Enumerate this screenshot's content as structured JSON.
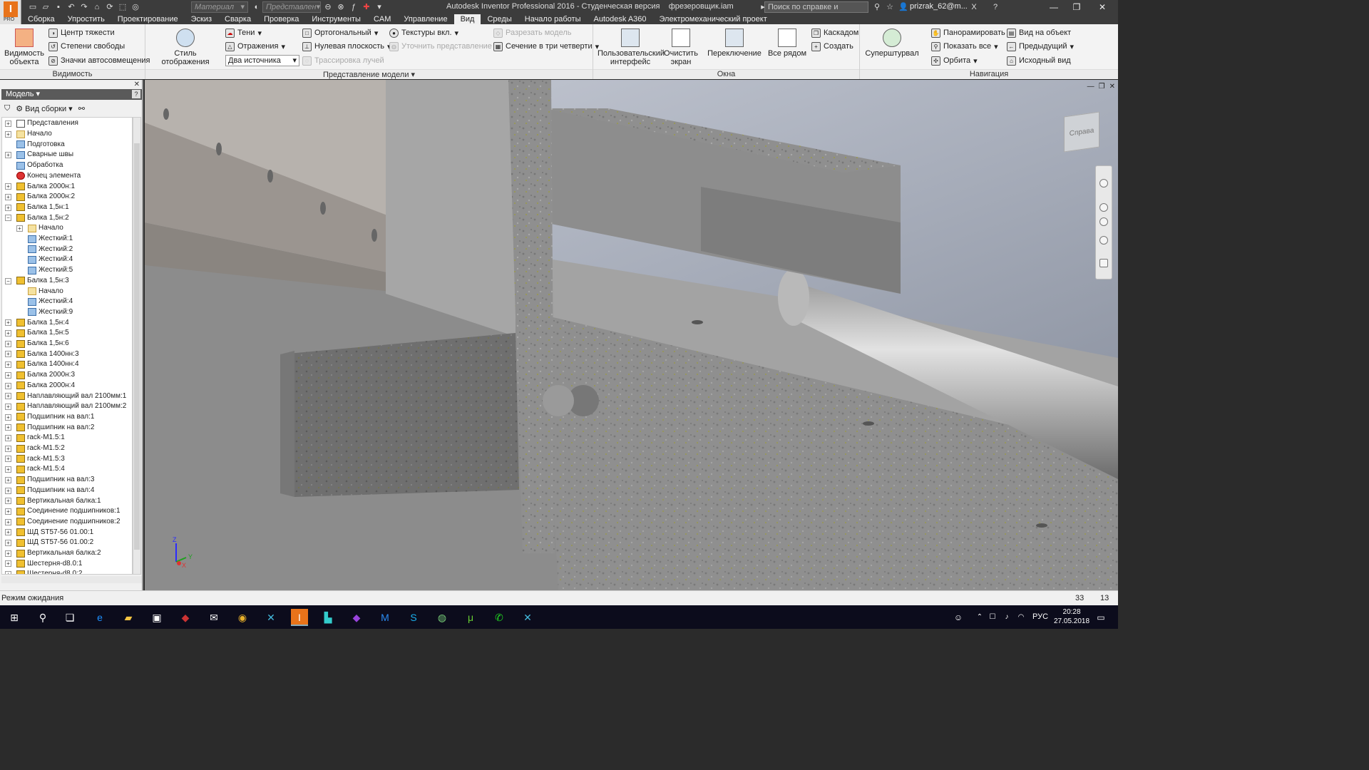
{
  "titlebar": {
    "app_logo": "I",
    "app_edition": "PRO",
    "material_placeholder": "Материал",
    "appearance_placeholder": "Представлен",
    "window_title": "Autodesk Inventor Professional 2016 - Студенческая версия    фрезеровщик.iam",
    "search_placeholder": "Поиск по справке и командам",
    "user": "prizrak_62@m..."
  },
  "tabs": [
    "Сборка",
    "Упростить",
    "Проектирование",
    "Эскиз",
    "Сварка",
    "Проверка",
    "Инструменты",
    "CAM",
    "Управление",
    "Вид",
    "Среды",
    "Начало работы",
    "Autodesk A360",
    "Электромеханический проект"
  ],
  "active_tab": "Вид",
  "ribbon": {
    "visibility": {
      "label": "Видимость",
      "object_visibility": "Видимость объекта",
      "center_of_gravity": "Центр тяжести",
      "dof": "Степени свободы",
      "icons": "Значки автосовмещения"
    },
    "model_repr": {
      "label": "Представление модели",
      "visual_style": "Стиль отображения",
      "shadows": "Тени",
      "reflections": "Отражения",
      "lights_combo": "Два источника",
      "ortho": "Ортогональный",
      "ground_plane": "Нулевая плоскость",
      "ray_trace": "Трассировка лучей",
      "textures": "Текстуры вкл.",
      "refine": "Уточнить представление",
      "slice": "Разрезать модель",
      "section": "Сечение в три четверти"
    },
    "windows": {
      "label": "Окна",
      "user_interface": "Пользовательский интерфейс",
      "clear_screen": "Очистить экран",
      "switch": "Переключение",
      "tile": "Все рядом",
      "cascade": "Каскадом",
      "new": "Создать"
    },
    "navigation": {
      "label": "Навигация",
      "steering": "Суперштурвал",
      "pan": "Панорамировать",
      "zoom_all": "Показать все",
      "orbit": "Орбита",
      "look_at": "Вид на объект",
      "previous": "Предыдущий",
      "home": "Исходный вид"
    }
  },
  "browser": {
    "title": "Модель",
    "view": "Вид сборки",
    "nodes": [
      {
        "label": "Представления",
        "icon": "doc",
        "level": 0,
        "exp": "+"
      },
      {
        "label": "Начало",
        "icon": "folder",
        "level": 0,
        "exp": "+"
      },
      {
        "label": "Подготовка",
        "icon": "blue",
        "level": 0,
        "exp": ""
      },
      {
        "label": "Сварные швы",
        "icon": "blue",
        "level": 0,
        "exp": "+"
      },
      {
        "label": "Обработка",
        "icon": "blue",
        "level": 0,
        "exp": ""
      },
      {
        "label": "Конец элемента",
        "icon": "red",
        "level": 0,
        "exp": ""
      },
      {
        "label": "Балка 2000н:1",
        "icon": "part",
        "level": 0,
        "exp": "+"
      },
      {
        "label": "Балка 2000н:2",
        "icon": "part",
        "level": 0,
        "exp": "+"
      },
      {
        "label": "Балка 1,5н:1",
        "icon": "part",
        "level": 0,
        "exp": "+"
      },
      {
        "label": "Балка 1,5н:2",
        "icon": "part",
        "level": 0,
        "exp": "-"
      },
      {
        "label": "Начало",
        "icon": "folder",
        "level": 1,
        "exp": "+"
      },
      {
        "label": "Жесткий:1",
        "icon": "blue",
        "level": 1,
        "exp": ""
      },
      {
        "label": "Жесткий:2",
        "icon": "blue",
        "level": 1,
        "exp": ""
      },
      {
        "label": "Жесткий:4",
        "icon": "blue",
        "level": 1,
        "exp": ""
      },
      {
        "label": "Жесткий:5",
        "icon": "blue",
        "level": 1,
        "exp": ""
      },
      {
        "label": "Балка 1,5н:3",
        "icon": "part",
        "level": 0,
        "exp": "-"
      },
      {
        "label": "Начало",
        "icon": "folder",
        "level": 1,
        "exp": ""
      },
      {
        "label": "Жесткий:4",
        "icon": "blue",
        "level": 1,
        "exp": ""
      },
      {
        "label": "Жесткий:9",
        "icon": "blue",
        "level": 1,
        "exp": ""
      },
      {
        "label": "Балка 1,5н:4",
        "icon": "part",
        "level": 0,
        "exp": "+"
      },
      {
        "label": "Балка 1,5н:5",
        "icon": "part",
        "level": 0,
        "exp": "+"
      },
      {
        "label": "Балка 1,5н:6",
        "icon": "part",
        "level": 0,
        "exp": "+"
      },
      {
        "label": "Балка 1400нн:3",
        "icon": "part",
        "level": 0,
        "exp": "+"
      },
      {
        "label": "Балка 1400нн:4",
        "icon": "part",
        "level": 0,
        "exp": "+"
      },
      {
        "label": "Балка 2000н:3",
        "icon": "part",
        "level": 0,
        "exp": "+"
      },
      {
        "label": "Балка 2000н:4",
        "icon": "part",
        "level": 0,
        "exp": "+"
      },
      {
        "label": "Наплавляющий вал 2100мм:1",
        "icon": "part",
        "level": 0,
        "exp": "+"
      },
      {
        "label": "Наплавляющий вал 2100мм:2",
        "icon": "part",
        "level": 0,
        "exp": "+"
      },
      {
        "label": "Подшипник на вал:1",
        "icon": "part",
        "level": 0,
        "exp": "+"
      },
      {
        "label": "Подшипник на вал:2",
        "icon": "part",
        "level": 0,
        "exp": "+"
      },
      {
        "label": "rack-M1.5:1",
        "icon": "part",
        "level": 0,
        "exp": "+"
      },
      {
        "label": "rack-M1.5:2",
        "icon": "part",
        "level": 0,
        "exp": "+"
      },
      {
        "label": "rack-M1.5:3",
        "icon": "part",
        "level": 0,
        "exp": "+"
      },
      {
        "label": "rack-M1.5:4",
        "icon": "part",
        "level": 0,
        "exp": "+"
      },
      {
        "label": "Подшипник на вал:3",
        "icon": "part",
        "level": 0,
        "exp": "+"
      },
      {
        "label": "Подшипник на вал:4",
        "icon": "part",
        "level": 0,
        "exp": "+"
      },
      {
        "label": "Вертикальная балка:1",
        "icon": "part",
        "level": 0,
        "exp": "+"
      },
      {
        "label": "Соединение подшипников:1",
        "icon": "part",
        "level": 0,
        "exp": "+"
      },
      {
        "label": "Соединение подшипников:2",
        "icon": "part",
        "level": 0,
        "exp": "+"
      },
      {
        "label": "ШД ST57-56 01.00:1",
        "icon": "part",
        "level": 0,
        "exp": "+"
      },
      {
        "label": "ШД ST57-56 01.00:2",
        "icon": "part",
        "level": 0,
        "exp": "+"
      },
      {
        "label": "Вертикальная балка:2",
        "icon": "part",
        "level": 0,
        "exp": "+"
      },
      {
        "label": "Шестерня-d8.0:1",
        "icon": "part",
        "level": 0,
        "exp": "+"
      },
      {
        "label": "Шестерня-d8.0:2",
        "icon": "part",
        "level": 0,
        "exp": "+"
      }
    ]
  },
  "viewport": {
    "viewcube_face": "Справа",
    "axis_x": "X",
    "axis_y": "Y",
    "axis_z": "Z"
  },
  "status": {
    "text": "Режим ожидания",
    "count1": "33",
    "count2": "13"
  },
  "taskbar": {
    "lang": "РУС",
    "time": "20:28",
    "date": "27.05.2018"
  }
}
